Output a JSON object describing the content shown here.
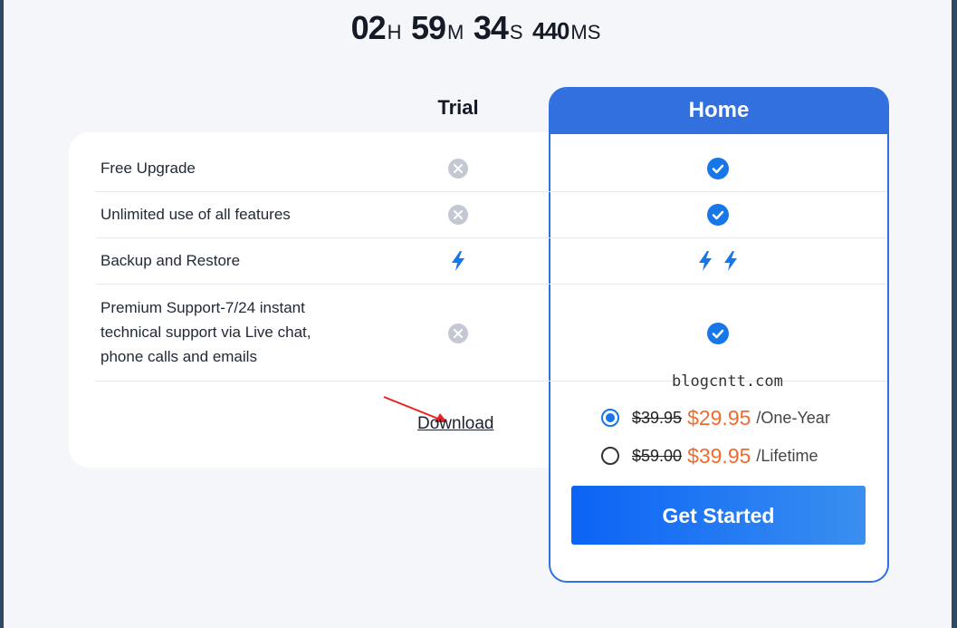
{
  "timer": {
    "hours": "02",
    "hours_unit": "H",
    "minutes": "59",
    "minutes_unit": "M",
    "seconds": "34",
    "seconds_unit": "S",
    "ms": "440",
    "ms_unit": "MS"
  },
  "plans": {
    "trial": "Trial",
    "home": "Home"
  },
  "features": [
    {
      "label": "Free Upgrade",
      "trial": "x-icon",
      "home": "check-icon"
    },
    {
      "label": "Unlimited use of all features",
      "trial": "x-icon",
      "home": "check-icon"
    },
    {
      "label": "Backup and Restore",
      "trial": "bolt-icon",
      "home": "double-bolt-icon"
    },
    {
      "label_lines": [
        "Premium Support-7/24 instant",
        "technical support via Live chat,",
        "phone calls and emails"
      ],
      "trial": "x-icon",
      "home": "check-icon"
    }
  ],
  "download_label": "Download",
  "watermark": "blogcntt.com",
  "pricing": [
    {
      "old": "$39.95",
      "new": "$29.95",
      "per": "/One-Year",
      "selected": true
    },
    {
      "old": "$59.00",
      "new": "$39.95",
      "per": "/Lifetime",
      "selected": false
    }
  ],
  "cta_label": "Get Started",
  "colors": {
    "accent": "#3270e0",
    "price": "#f26a2e",
    "check": "#1776e8",
    "disabled": "#c3c8d2"
  }
}
